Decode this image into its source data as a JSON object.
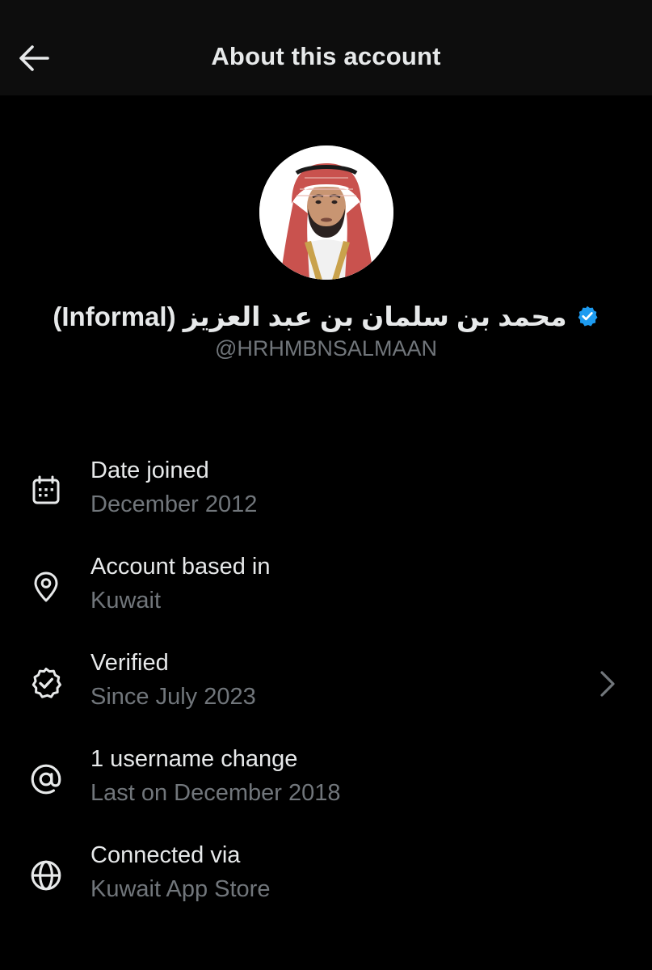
{
  "header": {
    "title": "About this account",
    "back_icon": "arrow-left-icon"
  },
  "profile": {
    "display_name": "محمد بن سلمان بن عبد العزيز (Informal)",
    "handle": "@HRHMBNSALMAAN",
    "verified_icon": "verified-badge-icon",
    "verified_color": "#1d9bf0"
  },
  "info": [
    {
      "icon": "calendar-icon",
      "title": "Date joined",
      "value": "December 2012"
    },
    {
      "icon": "location-pin-icon",
      "title": "Account based in",
      "value": "Kuwait"
    },
    {
      "icon": "verified-check-icon",
      "title": "Verified",
      "value": "Since July 2023",
      "chevron_icon": "chevron-right-icon"
    },
    {
      "icon": "at-sign-icon",
      "title": "1 username change",
      "value": "Last on December 2018"
    },
    {
      "icon": "globe-icon",
      "title": "Connected via",
      "value": "Kuwait App Store"
    }
  ],
  "colors": {
    "background": "#000000",
    "header_background": "#0d0d0d",
    "primary_text": "#e7e9ea",
    "secondary_text": "#71767b"
  }
}
